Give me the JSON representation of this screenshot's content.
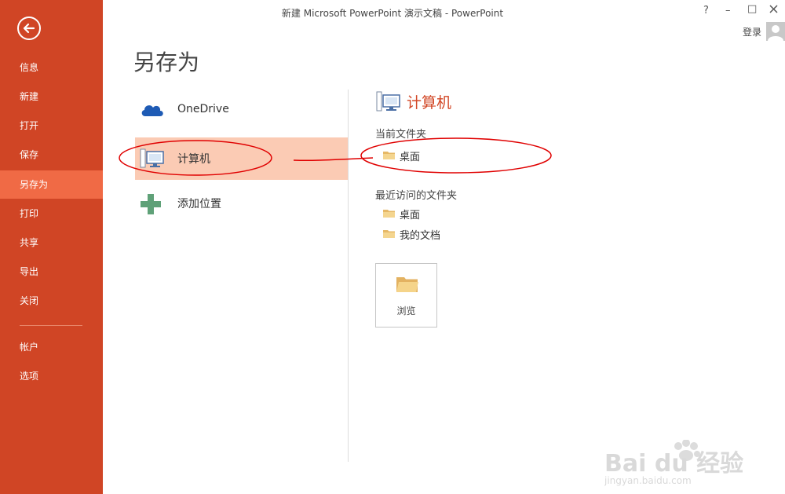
{
  "window": {
    "title": "新建 Microsoft PowerPoint 演示文稿 - PowerPoint",
    "help_label": "?",
    "minimize_label": "–",
    "maximize_label": "□",
    "signin_label": "登录"
  },
  "sidebar": {
    "items": [
      {
        "label": "信息"
      },
      {
        "label": "新建"
      },
      {
        "label": "打开"
      },
      {
        "label": "保存"
      },
      {
        "label": "另存为",
        "active": true
      },
      {
        "label": "打印"
      },
      {
        "label": "共享"
      },
      {
        "label": "导出"
      },
      {
        "label": "关闭"
      },
      {
        "label": "帐户"
      },
      {
        "label": "选项"
      }
    ]
  },
  "page": {
    "title": "另存为"
  },
  "places": [
    {
      "label": "OneDrive",
      "icon": "cloud-icon"
    },
    {
      "label": "计算机",
      "icon": "computer-icon",
      "selected": true
    },
    {
      "label": "添加位置",
      "icon": "plus-icon"
    }
  ],
  "right_panel": {
    "title": "计算机",
    "current_folder_label": "当前文件夹",
    "current_folder": "桌面",
    "recent_label": "最近访问的文件夹",
    "recent_folders": [
      "桌面",
      "我的文档"
    ],
    "browse_label": "浏览"
  },
  "watermark": {
    "brand": "Bai du 经验",
    "url": "jingyan.baidu.com"
  },
  "colors": {
    "accent": "#d04525",
    "selected": "#fbcbb4",
    "annotation": "#e00000"
  }
}
